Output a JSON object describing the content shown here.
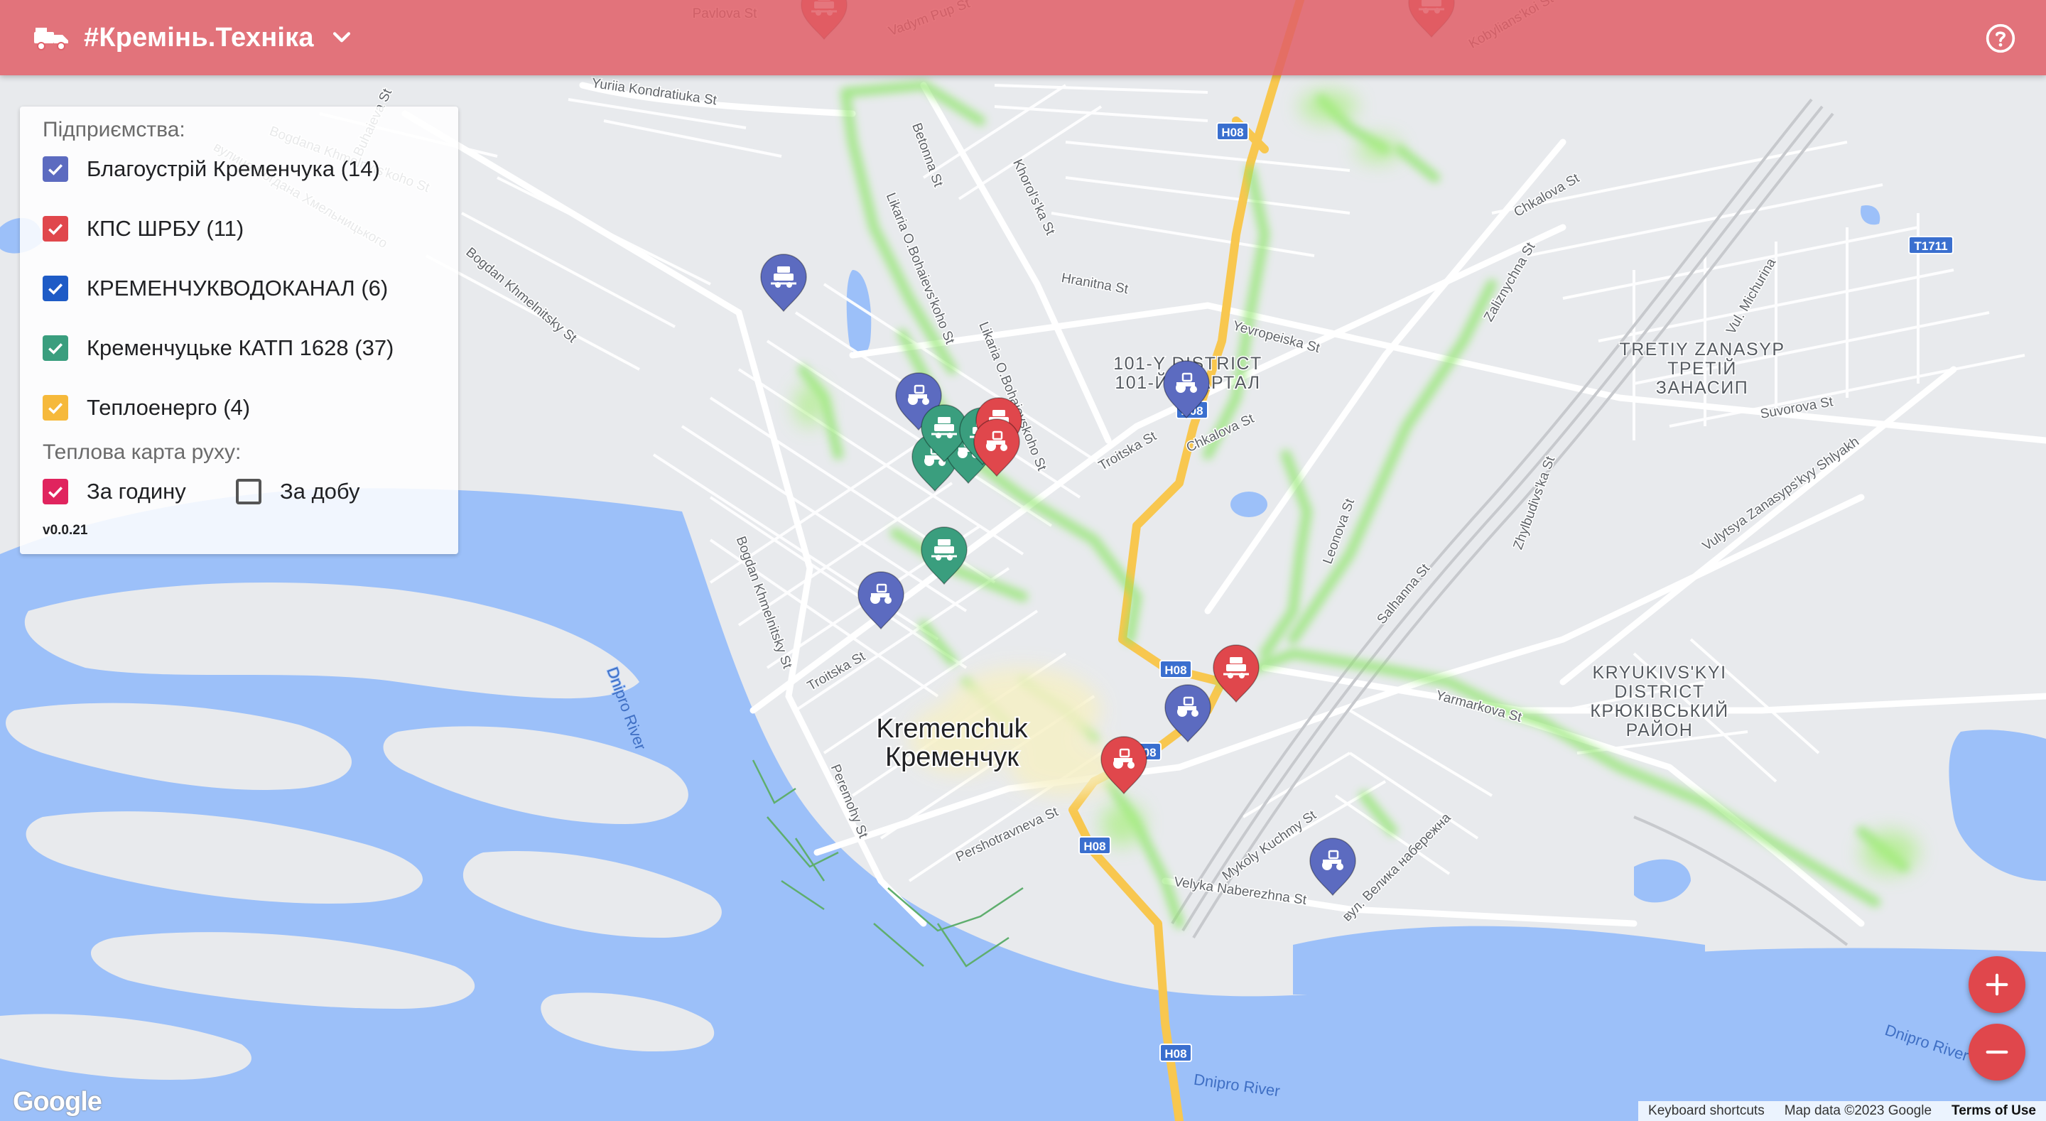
{
  "app": {
    "title": "#Кремінь.Техніка"
  },
  "panel": {
    "companies_heading": "Підприємства:",
    "companies": [
      {
        "label": "Благоустрій Кременчука (14)",
        "color": "#5c6bc0",
        "checked": true
      },
      {
        "label": "КПС ШРБУ (11)",
        "color": "#e0474c",
        "checked": true
      },
      {
        "label": "КРЕМЕНЧУКВОДОКАНАЛ (6)",
        "color": "#1e5bc6",
        "checked": true
      },
      {
        "label": "Кременчуцьке КАТП 1628 (37)",
        "color": "#3a9e7e",
        "checked": true
      },
      {
        "label": "Теплоенерго (4)",
        "color": "#f6b93b",
        "checked": true
      }
    ],
    "heatmap_heading": "Теплова карта руху:",
    "heatmap_hour": {
      "label": "За годину",
      "checked": true,
      "color": "#e0245e"
    },
    "heatmap_day": {
      "label": "За добу",
      "checked": false
    },
    "version": "v0.0.21"
  },
  "map": {
    "city_label_en": "Kremenchuk",
    "city_label_uk": "Кременчук",
    "districts": [
      {
        "lines": [
          "101-Y DISTRICT",
          "101-Й КВАРТАЛ"
        ]
      },
      {
        "lines": [
          "TRETIY ZANASYP",
          "ТРЕТІЙ",
          "ЗАНАСИП"
        ]
      },
      {
        "lines": [
          "KRYUKIVS'KYI",
          "DISTRICT",
          "КРЮКІВСЬКИЙ",
          "РАЙОН"
        ]
      }
    ],
    "rivers": [
      "Dnipro River",
      "Dnipro River",
      "Dnipro River"
    ],
    "streets": [
      "Yuriia Kondratiuka St",
      "Betonna St",
      "Khorol's'ka St",
      "Likaria O.Bohaievs'koho St",
      "Likaria O.Bohaievskoho St",
      "Hranitna St",
      "Yevropeiska St",
      "Chkalova St",
      "Chkalova St",
      "Bogdan Khmelnitsky St",
      "Bogdan Khmelnitsky St",
      "Troitska St",
      "Troitska St",
      "Peremohy St",
      "Pershotravneva St",
      "Mykoly Kuchmy St",
      "Velyka Naberezhna St",
      "вул. Велика набережна",
      "Suvorova St",
      "Zaliznychna St",
      "Vul. Michurina",
      "Vulytsya Zanasyps'kyy Shlyakh",
      "Zhylbudivs'ka St",
      "Leonova St",
      "Salhanna St",
      "Yarmarkova St",
      "вулиця Богдана Хмельницького",
      "Buhaieva St",
      "Bogdana Khmelnyts'koho St",
      "Pavlova St",
      "Vadym Pup St",
      "Kobylians'koi St"
    ],
    "road_shields": [
      "H08",
      "H08",
      "H08",
      "H08",
      "H08",
      "H08",
      "T1711"
    ],
    "markers": [
      {
        "company": "Благоустрій Кременчука",
        "type": "sweeper"
      },
      {
        "company": "Благоустрій Кременчука",
        "type": "tractor"
      },
      {
        "company": "Благоустрій Кременчука",
        "type": "tractor"
      },
      {
        "company": "Благоустрій Кременчука",
        "type": "tractor"
      },
      {
        "company": "Благоустрій Кременчука",
        "type": "tractor"
      },
      {
        "company": "Благоустрій Кременчука",
        "type": "tractor"
      },
      {
        "company": "Кременчуцьке КАТП 1628",
        "type": "tractor"
      },
      {
        "company": "Кременчуцьке КАТП 1628",
        "type": "tractor"
      },
      {
        "company": "Кременчуцьке КАТП 1628",
        "type": "sweeper"
      },
      {
        "company": "Кременчуцьке КАТП 1628",
        "type": "sweeper"
      },
      {
        "company": "Кременчуцьке КАТП 1628",
        "type": "sweeper"
      },
      {
        "company": "КПС ШРБУ",
        "type": "sweeper"
      },
      {
        "company": "КПС ШРБУ",
        "type": "tractor"
      },
      {
        "company": "КПС ШРБУ",
        "type": "sweeper"
      },
      {
        "company": "КПС ШРБУ",
        "type": "tractor"
      },
      {
        "company": "КПС ШРБУ",
        "type": "sweeper"
      },
      {
        "company": "КПС ШРБУ",
        "type": "sweeper"
      }
    ]
  },
  "attribution": {
    "google": "Google",
    "keyboard": "Keyboard shortcuts",
    "map_data": "Map data ©2023 Google",
    "terms": "Terms of Use"
  },
  "icons": {
    "logo": "truck-icon",
    "dropdown": "chevron-down-icon",
    "help": "help-circle-icon",
    "zoom_in": "plus-icon",
    "zoom_out": "minus-icon",
    "check": "check-icon"
  },
  "colors": {
    "topbar": "#e1606a",
    "water": "#9cc0f9",
    "land": "#e8eaed",
    "heat": "#8ee66b",
    "highway": "#f8c74f"
  }
}
